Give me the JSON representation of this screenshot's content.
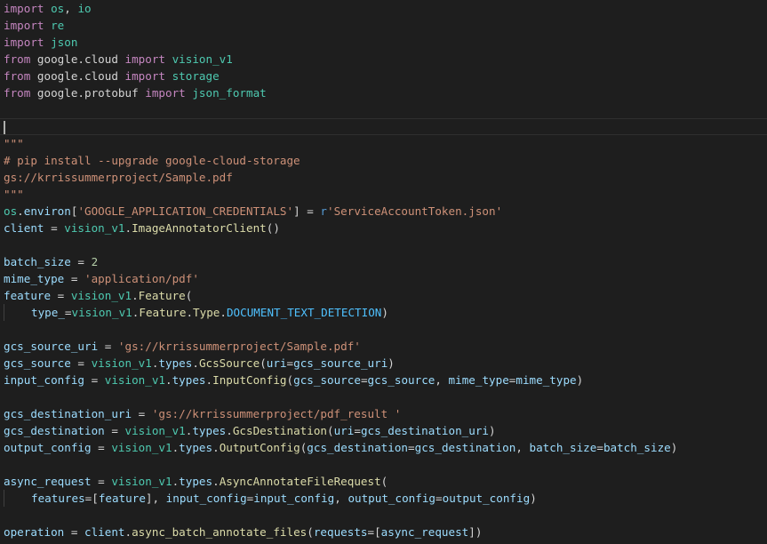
{
  "colors": {
    "background": "#1e1e1e",
    "keyword": "#c586c0",
    "module": "#4ec9b0",
    "variable": "#9cdcfe",
    "function": "#dcdcaa",
    "string": "#ce9178",
    "number": "#b5cea8",
    "constant": "#4fc1ff",
    "plain": "#d4d4d4",
    "prefix": "#569cd6"
  },
  "editor": {
    "lines": [
      {
        "tokens": [
          [
            "kw",
            "import"
          ],
          [
            "pl",
            " "
          ],
          [
            "mod",
            "os"
          ],
          [
            "pl",
            ", "
          ],
          [
            "mod",
            "io"
          ]
        ]
      },
      {
        "tokens": [
          [
            "kw",
            "import"
          ],
          [
            "pl",
            " "
          ],
          [
            "mod",
            "re"
          ]
        ]
      },
      {
        "tokens": [
          [
            "kw",
            "import"
          ],
          [
            "pl",
            " "
          ],
          [
            "mod",
            "json"
          ]
        ]
      },
      {
        "tokens": [
          [
            "kw",
            "from"
          ],
          [
            "pl",
            " google.cloud "
          ],
          [
            "kw",
            "import"
          ],
          [
            "pl",
            " "
          ],
          [
            "mod",
            "vision_v1"
          ]
        ]
      },
      {
        "tokens": [
          [
            "kw",
            "from"
          ],
          [
            "pl",
            " google.cloud "
          ],
          [
            "kw",
            "import"
          ],
          [
            "pl",
            " "
          ],
          [
            "mod",
            "storage"
          ]
        ]
      },
      {
        "tokens": [
          [
            "kw",
            "from"
          ],
          [
            "pl",
            " google.protobuf "
          ],
          [
            "kw",
            "import"
          ],
          [
            "pl",
            " "
          ],
          [
            "mod",
            "json_format"
          ]
        ]
      },
      {
        "tokens": []
      },
      {
        "active": true,
        "cursor": true,
        "tokens": []
      },
      {
        "tokens": [
          [
            "str",
            "\"\"\""
          ]
        ]
      },
      {
        "tokens": [
          [
            "str",
            "# pip install --upgrade google-cloud-storage"
          ]
        ]
      },
      {
        "tokens": [
          [
            "str",
            "gs://krrissummerproject/Sample.pdf"
          ]
        ]
      },
      {
        "tokens": [
          [
            "str",
            "\"\"\""
          ]
        ]
      },
      {
        "tokens": [
          [
            "mod",
            "os"
          ],
          [
            "pl",
            "."
          ],
          [
            "id",
            "environ"
          ],
          [
            "pl",
            "["
          ],
          [
            "str",
            "'GOOGLE_APPLICATION_CREDENTIALS'"
          ],
          [
            "pl",
            "] = "
          ],
          [
            "pre",
            "r"
          ],
          [
            "str",
            "'ServiceAccountToken.json'"
          ]
        ]
      },
      {
        "tokens": [
          [
            "id",
            "client"
          ],
          [
            "pl",
            " = "
          ],
          [
            "mod",
            "vision_v1"
          ],
          [
            "pl",
            "."
          ],
          [
            "fn",
            "ImageAnnotatorClient"
          ],
          [
            "pl",
            "()"
          ]
        ]
      },
      {
        "tokens": []
      },
      {
        "tokens": [
          [
            "id",
            "batch_size"
          ],
          [
            "pl",
            " = "
          ],
          [
            "num",
            "2"
          ]
        ]
      },
      {
        "tokens": [
          [
            "id",
            "mime_type"
          ],
          [
            "pl",
            " = "
          ],
          [
            "str",
            "'application/pdf'"
          ]
        ]
      },
      {
        "tokens": [
          [
            "id",
            "feature"
          ],
          [
            "pl",
            " = "
          ],
          [
            "mod",
            "vision_v1"
          ],
          [
            "pl",
            "."
          ],
          [
            "fn",
            "Feature"
          ],
          [
            "pl",
            "("
          ]
        ]
      },
      {
        "indent": true,
        "tokens": [
          [
            "id",
            "type_"
          ],
          [
            "pl",
            "="
          ],
          [
            "mod",
            "vision_v1"
          ],
          [
            "pl",
            "."
          ],
          [
            "fn",
            "Feature"
          ],
          [
            "pl",
            "."
          ],
          [
            "fn",
            "Type"
          ],
          [
            "pl",
            "."
          ],
          [
            "const",
            "DOCUMENT_TEXT_DETECTION"
          ],
          [
            "pl",
            ")"
          ]
        ]
      },
      {
        "tokens": []
      },
      {
        "tokens": [
          [
            "id",
            "gcs_source_uri"
          ],
          [
            "pl",
            " = "
          ],
          [
            "str",
            "'gs://krrissummerproject/Sample.pdf'"
          ]
        ]
      },
      {
        "tokens": [
          [
            "id",
            "gcs_source"
          ],
          [
            "pl",
            " = "
          ],
          [
            "mod",
            "vision_v1"
          ],
          [
            "pl",
            "."
          ],
          [
            "id",
            "types"
          ],
          [
            "pl",
            "."
          ],
          [
            "fn",
            "GcsSource"
          ],
          [
            "pl",
            "("
          ],
          [
            "id",
            "uri"
          ],
          [
            "pl",
            "="
          ],
          [
            "id",
            "gcs_source_uri"
          ],
          [
            "pl",
            ")"
          ]
        ]
      },
      {
        "tokens": [
          [
            "id",
            "input_config"
          ],
          [
            "pl",
            " = "
          ],
          [
            "mod",
            "vision_v1"
          ],
          [
            "pl",
            "."
          ],
          [
            "id",
            "types"
          ],
          [
            "pl",
            "."
          ],
          [
            "fn",
            "InputConfig"
          ],
          [
            "pl",
            "("
          ],
          [
            "id",
            "gcs_source"
          ],
          [
            "pl",
            "="
          ],
          [
            "id",
            "gcs_source"
          ],
          [
            "pl",
            ", "
          ],
          [
            "id",
            "mime_type"
          ],
          [
            "pl",
            "="
          ],
          [
            "id",
            "mime_type"
          ],
          [
            "pl",
            ")"
          ]
        ]
      },
      {
        "tokens": []
      },
      {
        "tokens": [
          [
            "id",
            "gcs_destination_uri"
          ],
          [
            "pl",
            " = "
          ],
          [
            "str",
            "'gs://krrissummerproject/pdf_result '"
          ]
        ]
      },
      {
        "tokens": [
          [
            "id",
            "gcs_destination"
          ],
          [
            "pl",
            " = "
          ],
          [
            "mod",
            "vision_v1"
          ],
          [
            "pl",
            "."
          ],
          [
            "id",
            "types"
          ],
          [
            "pl",
            "."
          ],
          [
            "fn",
            "GcsDestination"
          ],
          [
            "pl",
            "("
          ],
          [
            "id",
            "uri"
          ],
          [
            "pl",
            "="
          ],
          [
            "id",
            "gcs_destination_uri"
          ],
          [
            "pl",
            ")"
          ]
        ]
      },
      {
        "tokens": [
          [
            "id",
            "output_config"
          ],
          [
            "pl",
            " = "
          ],
          [
            "mod",
            "vision_v1"
          ],
          [
            "pl",
            "."
          ],
          [
            "id",
            "types"
          ],
          [
            "pl",
            "."
          ],
          [
            "fn",
            "OutputConfig"
          ],
          [
            "pl",
            "("
          ],
          [
            "id",
            "gcs_destination"
          ],
          [
            "pl",
            "="
          ],
          [
            "id",
            "gcs_destination"
          ],
          [
            "pl",
            ", "
          ],
          [
            "id",
            "batch_size"
          ],
          [
            "pl",
            "="
          ],
          [
            "id",
            "batch_size"
          ],
          [
            "pl",
            ")"
          ]
        ]
      },
      {
        "tokens": []
      },
      {
        "tokens": [
          [
            "id",
            "async_request"
          ],
          [
            "pl",
            " = "
          ],
          [
            "mod",
            "vision_v1"
          ],
          [
            "pl",
            "."
          ],
          [
            "id",
            "types"
          ],
          [
            "pl",
            "."
          ],
          [
            "fn",
            "AsyncAnnotateFileRequest"
          ],
          [
            "pl",
            "("
          ]
        ]
      },
      {
        "indent": true,
        "tokens": [
          [
            "id",
            "features"
          ],
          [
            "pl",
            "=["
          ],
          [
            "id",
            "feature"
          ],
          [
            "pl",
            "], "
          ],
          [
            "id",
            "input_config"
          ],
          [
            "pl",
            "="
          ],
          [
            "id",
            "input_config"
          ],
          [
            "pl",
            ", "
          ],
          [
            "id",
            "output_config"
          ],
          [
            "pl",
            "="
          ],
          [
            "id",
            "output_config"
          ],
          [
            "pl",
            ")"
          ]
        ]
      },
      {
        "tokens": []
      },
      {
        "tokens": [
          [
            "id",
            "operation"
          ],
          [
            "pl",
            " = "
          ],
          [
            "id",
            "client"
          ],
          [
            "pl",
            "."
          ],
          [
            "fn",
            "async_batch_annotate_files"
          ],
          [
            "pl",
            "("
          ],
          [
            "id",
            "requests"
          ],
          [
            "pl",
            "=["
          ],
          [
            "id",
            "async_request"
          ],
          [
            "pl",
            "])"
          ]
        ]
      }
    ]
  }
}
